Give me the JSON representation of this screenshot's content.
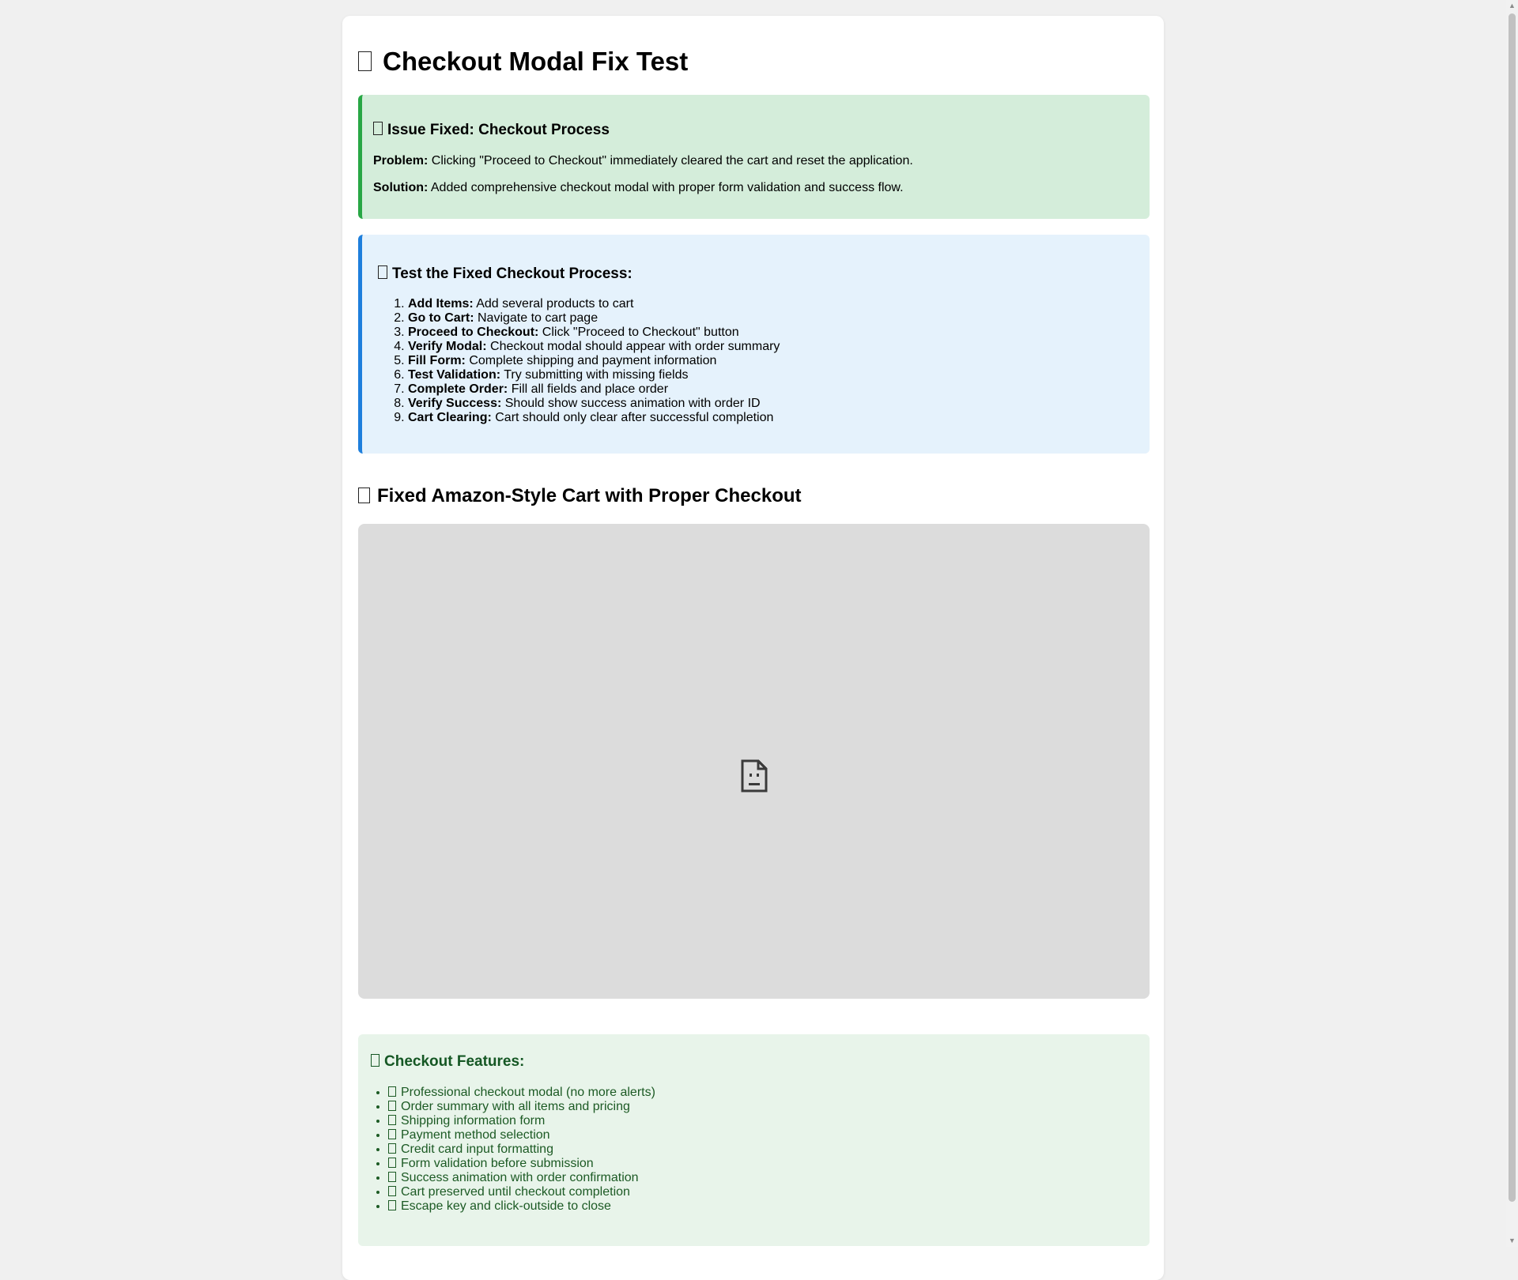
{
  "page": {
    "title": "Checkout Modal Fix Test"
  },
  "issue_fixed": {
    "heading": "Issue Fixed: Checkout Process",
    "problem_label": "Problem:",
    "problem_text": " Clicking \"Proceed to Checkout\" immediately cleared the cart and reset the application.",
    "solution_label": "Solution:",
    "solution_text": " Added comprehensive checkout modal with proper form validation and success flow."
  },
  "test_steps": {
    "heading": "Test the Fixed Checkout Process:",
    "items": [
      {
        "label": "Add Items:",
        "text": " Add several products to cart"
      },
      {
        "label": "Go to Cart:",
        "text": " Navigate to cart page"
      },
      {
        "label": "Proceed to Checkout:",
        "text": " Click \"Proceed to Checkout\" button"
      },
      {
        "label": "Verify Modal:",
        "text": " Checkout modal should appear with order summary"
      },
      {
        "label": "Fill Form:",
        "text": " Complete shipping and payment information"
      },
      {
        "label": "Test Validation:",
        "text": " Try submitting with missing fields"
      },
      {
        "label": "Complete Order:",
        "text": " Fill all fields and place order"
      },
      {
        "label": "Verify Success:",
        "text": " Should show success animation with order ID"
      },
      {
        "label": "Cart Clearing:",
        "text": " Cart should only clear after successful completion"
      }
    ]
  },
  "cart_section": {
    "heading": "Fixed Amazon-Style Cart with Proper Checkout",
    "frame_icon": "broken-page-icon"
  },
  "features": {
    "heading": "Checkout Features:",
    "items": [
      "Professional checkout modal (no more alerts)",
      "Order summary with all items and pricing",
      "Shipping information form",
      "Payment method selection",
      "Credit card input formatting",
      "Form validation before submission",
      "Success animation with order confirmation",
      "Cart preserved until checkout completion",
      "Escape key and click-outside to close"
    ]
  },
  "colors": {
    "page_bg": "#f0f0f0",
    "success_bg": "#d4edda",
    "success_border": "#28a745",
    "info_bg": "#e5f2fc",
    "info_border": "#1e7fdc",
    "features_bg": "#e8f4ea",
    "features_text": "#155724"
  }
}
